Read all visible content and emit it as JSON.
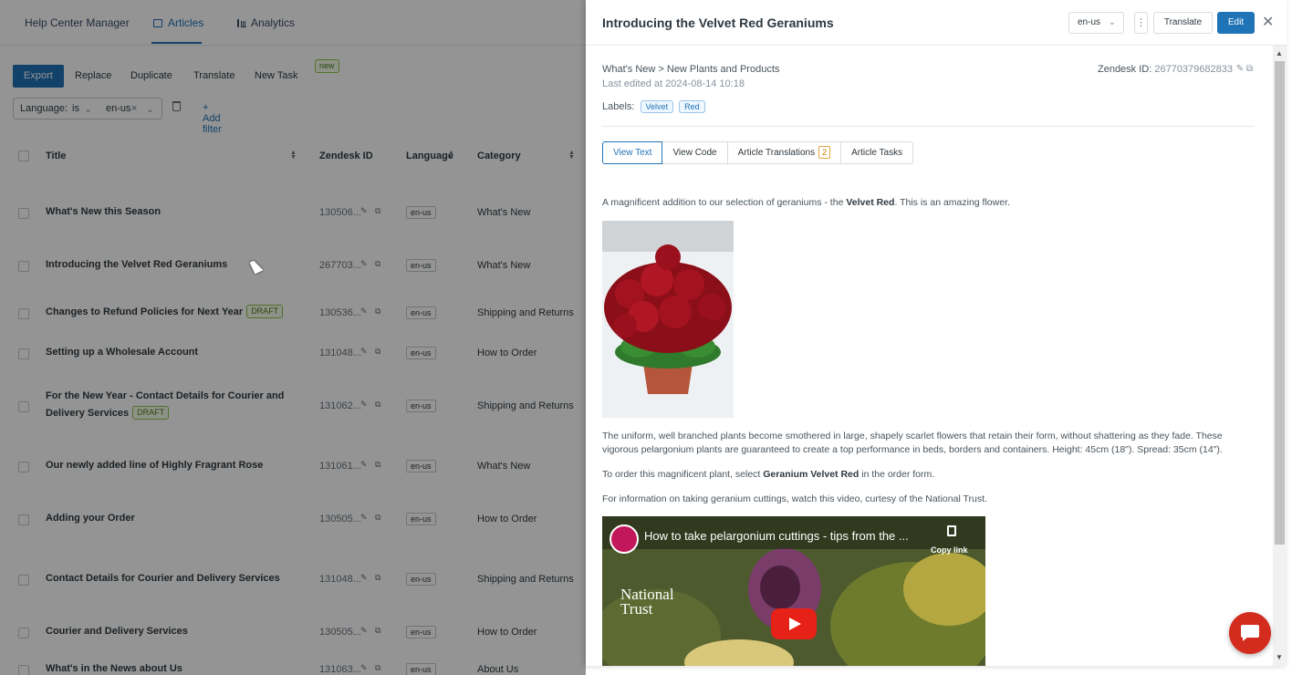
{
  "nav": {
    "app_name": "Help Center Manager",
    "tab_articles": "Articles",
    "tab_analytics": "Analytics"
  },
  "toolbar": {
    "export": "Export",
    "replace": "Replace",
    "duplicate": "Duplicate",
    "translate": "Translate",
    "new_task": "New Task",
    "new_badge": "new"
  },
  "filter": {
    "field": "Language:",
    "operator": "is",
    "value": "en-us",
    "add_filter": "+ Add filter"
  },
  "table": {
    "headers": {
      "title": "Title",
      "zendesk_id": "Zendesk ID",
      "language": "Language",
      "category": "Category"
    },
    "rows": [
      {
        "title": "What's New this Season",
        "id": "130506...",
        "lang": "en-us",
        "category": "What's New"
      },
      {
        "title": "Introducing the Velvet Red Geraniums",
        "id": "267703...",
        "lang": "en-us",
        "category": "What's New"
      },
      {
        "title": "Changes to Refund Policies for Next Year",
        "badge": "DRAFT",
        "id": "130536...",
        "lang": "en-us",
        "category": "Shipping and Returns"
      },
      {
        "title": "Setting up a Wholesale Account",
        "id": "131048...",
        "lang": "en-us",
        "category": "How to Order"
      },
      {
        "title": "For the New Year - Contact Details for Courier and Delivery Services",
        "badge": "DRAFT",
        "id": "131062...",
        "lang": "en-us",
        "category": "Shipping and Returns"
      },
      {
        "title": "Our newly added line of Highly Fragrant Rose",
        "id": "131061...",
        "lang": "en-us",
        "category": "What's New"
      },
      {
        "title": "Adding your Order",
        "id": "130505...",
        "lang": "en-us",
        "category": "How to Order"
      },
      {
        "title": "Contact Details for Courier and Delivery Services",
        "id": "131048...",
        "lang": "en-us",
        "category": "Shipping and Returns"
      },
      {
        "title": "Courier and Delivery Services",
        "id": "130505...",
        "lang": "en-us",
        "category": "How to Order"
      },
      {
        "title": "What's in the News about Us",
        "id": "131063...",
        "lang": "en-us",
        "category": "About Us"
      }
    ]
  },
  "panel": {
    "title": "Introducing the Velvet Red Geraniums",
    "lang": "en-us",
    "translate_label": "Translate",
    "edit_label": "Edit",
    "breadcrumb": "What's New > New Plants and Products",
    "last_edited": "Last edited at 2024-08-14 10:18",
    "zendesk_id_label": "Zendesk ID: ",
    "zendesk_id": "26770379682833",
    "labels_label": "Labels:",
    "labels": [
      "Velvet",
      "Red"
    ],
    "tabs": {
      "view_text": "View Text",
      "view_code": "View Code",
      "translations": "Article Translations",
      "translations_count": "2",
      "tasks": "Article Tasks"
    },
    "content": {
      "p1_a": "A magnificent addition to our selection of geraniums - the ",
      "p1_b": "Velvet Red",
      "p1_c": ". This is an amazing flower.",
      "p2": "The uniform, well branched plants become smothered in large, shapely scarlet flowers that retain their form, without shattering as they fade. These vigorous pelargonium plants are guaranteed to create a top performance in beds, borders and containers. Height: 45cm (18\"). Spread: 35cm (14\").",
      "p3_a": "To order this magnificent plant, select ",
      "p3_b": "Geranium Velvet Red",
      "p3_c": " in the order form.",
      "p4": "For information on taking geranium cuttings, watch this video, curtesy of the National Trust.",
      "video_title": "How to take pelargonium cuttings - tips from the ...",
      "video_copy": "Copy link",
      "video_brand_1": "National",
      "video_brand_2": "Trust"
    }
  },
  "colors": {
    "primary": "#1f73b7",
    "draft_green": "#8fc24a",
    "chat_red": "#d32b1e"
  }
}
